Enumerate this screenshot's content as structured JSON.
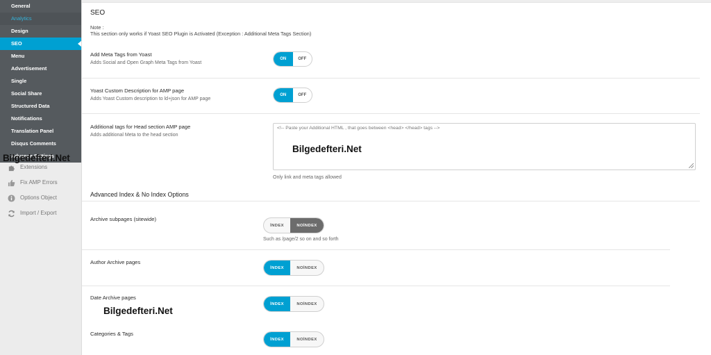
{
  "sidebar": {
    "items": [
      {
        "label": "General"
      },
      {
        "label": "Analytics"
      },
      {
        "label": "Design"
      },
      {
        "label": "SEO"
      },
      {
        "label": "Menu"
      },
      {
        "label": "Advertisement"
      },
      {
        "label": "Single"
      },
      {
        "label": "Social Share"
      },
      {
        "label": "Structured Data"
      },
      {
        "label": "Notifications"
      },
      {
        "label": "Translation Panel"
      },
      {
        "label": "Disqus Comments"
      },
      {
        "label": "Advance Settings"
      }
    ],
    "extras": [
      {
        "label": "Extensions",
        "icon": "puzzle-icon"
      },
      {
        "label": "Fix AMP Errors",
        "icon": "thumbs-up-icon"
      },
      {
        "label": "Options Object",
        "icon": "info-icon"
      },
      {
        "label": "Import / Export",
        "icon": "refresh-icon"
      }
    ],
    "watermark": "Bilgedefteri.Net"
  },
  "main": {
    "title": "SEO",
    "note_label": "Note :",
    "note_text": "This section only works if Yoast SEO Plugin is Activated (Exception : Additional Meta Tags Section)",
    "settings": [
      {
        "label": "Add Meta Tags from Yoast",
        "desc": "Adds Social and Open Graph Meta Tags from Yoast",
        "on": "ON",
        "off": "OFF",
        "state": "on"
      },
      {
        "label": "Yoast Custom Description for AMP page",
        "desc": "Adds Yoast Custom description to ld+json for AMP page",
        "on": "ON",
        "off": "OFF",
        "state": "on"
      }
    ],
    "head_tags": {
      "label": "Additional tags for Head section AMP page",
      "desc": "Adds additional Meta to the head section",
      "placeholder": "<!-- Paste your Additional HTML , that goes between <head> </head> tags -->",
      "watermark": "Bilgedefteri.Net",
      "help": "Only link and meta tags allowed"
    },
    "index_section": {
      "title": "Advanced Index & No Index Options",
      "options": [
        {
          "label": "Archive subpages (sitewide)",
          "index": "İNDEX",
          "noindex": "NOİNDEX",
          "selected": "noindex",
          "help": "Such as /page/2 so on and so forth"
        },
        {
          "label": "Author Archive pages",
          "index": "İNDEX",
          "noindex": "NOİNDEX",
          "selected": "index"
        },
        {
          "label": "Date Archive pages",
          "index": "İNDEX",
          "noindex": "NOİNDEX",
          "selected": "index"
        },
        {
          "label": "Categories & Tags",
          "index": "İNDEX",
          "noindex": "NOİNDEX",
          "selected": "index"
        }
      ],
      "watermark": "Bilgedefteri.Net"
    }
  },
  "colors": {
    "accent": "#00a0d2",
    "sidebar_dark": "#555a5e",
    "analytics_text": "#33b3db",
    "noindex_selected": "#6c6c6c"
  }
}
